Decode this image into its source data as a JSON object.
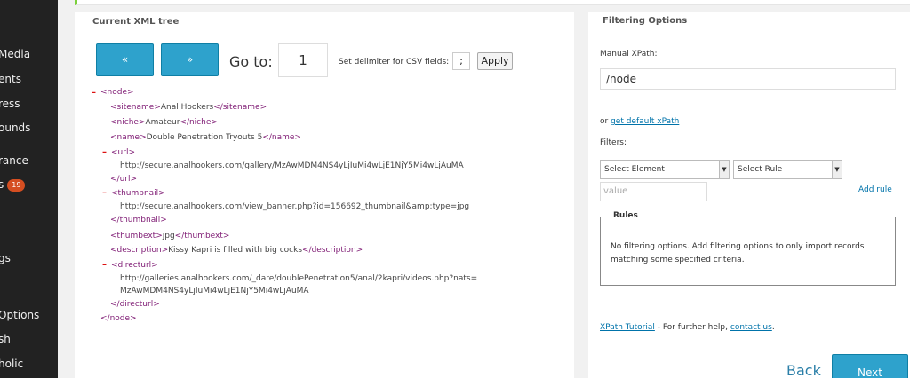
{
  "sidebar": {
    "items": [
      {
        "label": "Media"
      },
      {
        "label": "ents"
      },
      {
        "label": "ress"
      },
      {
        "label": "ounds"
      },
      {
        "label": "rance"
      },
      {
        "label": "s",
        "badge": "19"
      },
      {
        "label": "gs"
      },
      {
        "label": "Options"
      },
      {
        "label": "sh"
      },
      {
        "label": "holic"
      }
    ]
  },
  "xml_panel": {
    "title": "Current XML tree",
    "prev_label": "«",
    "next_label": "»",
    "goto_label": "Go to:",
    "goto_value": "1",
    "delimiter_label": "Set delimiter for CSV fields:",
    "delimiter_value": ";",
    "apply_label": "Apply",
    "tree": {
      "node_open": "<node>",
      "sitename": {
        "open": "<sitename>",
        "value": "Anal Hookers",
        "close": "</sitename>"
      },
      "niche": {
        "open": "<niche>",
        "value": "Amateur",
        "close": "</niche>"
      },
      "name": {
        "open": "<name>",
        "value": "Double Penetration Tryouts 5",
        "close": "</name>"
      },
      "url": {
        "open": "<url>",
        "value": "http://secure.analhookers.com/gallery/MzAwMDM4NS4yLjIuMi4wLjE1NjY5Mi4wLjAuMA",
        "close": "</url>"
      },
      "thumbnail": {
        "open": "<thumbnail>",
        "value": "http://secure.analhookers.com/view_banner.php?id=156692_thumbnail&amp;type=jpg",
        "close": "</thumbnail>"
      },
      "thumbext": {
        "open": "<thumbext>",
        "value": "jpg",
        "close": "</thumbext>"
      },
      "description": {
        "open": "<description>",
        "value": "Kissy Kapri is filled with big cocks",
        "close": "</description>"
      },
      "directurl": {
        "open": "<directurl>",
        "value_line1": "http://galleries.analhookers.com/_dare/doublePenetration5/anal/2kapri/videos.php?nats=",
        "value_line2": "MzAwMDM4NS4yLjIuMi4wLjE1NjY5Mi4wLjAuMA",
        "close": "</directurl>"
      },
      "node_close": "</node>",
      "collapse_symbol": "–"
    }
  },
  "filter_panel": {
    "title": "Filtering Options",
    "manual_xpath_label": "Manual XPath:",
    "xpath_value": "/node",
    "or_text": "or ",
    "default_xpath_link": "get default xPath",
    "filters_label": "Filters:",
    "select_element": "Select Element",
    "select_rule": "Select Rule",
    "value_placeholder": "value",
    "add_rule_link": "Add rule",
    "rules_legend": "Rules",
    "rules_text": "No filtering options. Add filtering options to only import records matching some specified criteria.",
    "xpath_tutorial_link": "XPath Tutorial",
    "help_text": " - For further help, ",
    "contact_link": "contact us",
    "help_end": "."
  },
  "footer": {
    "back_label": "Back",
    "next_label": "Next"
  },
  "colors": {
    "primary_button": "#2ea2cc",
    "sidebar_bg": "#222222",
    "accent_green": "#7ad03a",
    "xml_tag": "#7f1b74",
    "link": "#0073aa",
    "badge": "#d54e21"
  }
}
